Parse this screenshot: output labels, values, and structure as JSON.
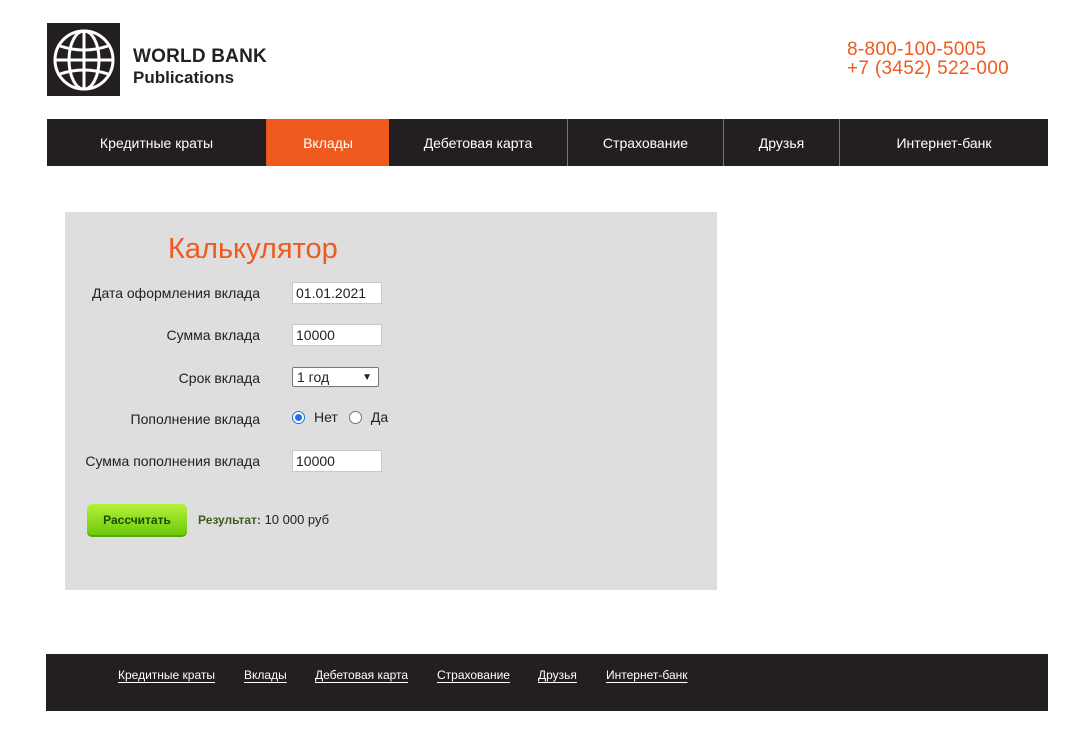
{
  "brand": {
    "line1": "WORLD BANK",
    "line2": "Publications",
    "logo_icon": "globe-icon"
  },
  "phones": [
    "8-800-100-5005",
    "+7 (3452) 522-000"
  ],
  "colors": {
    "accent": "#ef5a1f",
    "dark": "#231f20",
    "panel": "#dedede",
    "button": "#7fd416"
  },
  "nav": {
    "items": [
      {
        "label": "Кредитные краты",
        "active": false
      },
      {
        "label": "Вклады",
        "active": true
      },
      {
        "label": "Дебетовая карта",
        "active": false
      },
      {
        "label": "Страхование",
        "active": false
      },
      {
        "label": "Друзья",
        "active": false
      },
      {
        "label": "Интернет-банк",
        "active": false
      }
    ]
  },
  "calculator": {
    "title": "Калькулятор",
    "date_label": "Дата оформления вклада",
    "date_value": "01.01.2021",
    "amount_label": "Сумма вклада",
    "amount_value": "10000",
    "term_label": "Срок вклада",
    "term_value": "1 год",
    "topup_label": "Пополнение вклада",
    "topup_options": [
      {
        "label": "Нет",
        "checked": true
      },
      {
        "label": "Да",
        "checked": false
      }
    ],
    "topup_amount_label": "Сумма пополнения вклада",
    "topup_amount_value": "10000",
    "calc_button": "Рассчитать",
    "result_label": "Результат:",
    "result_value": "10 000 руб"
  },
  "footer": {
    "links": [
      "Кредитные краты",
      "Вклады",
      "Дебетовая карта",
      "Страхование",
      "Друзья",
      "Интернет-банк"
    ]
  }
}
